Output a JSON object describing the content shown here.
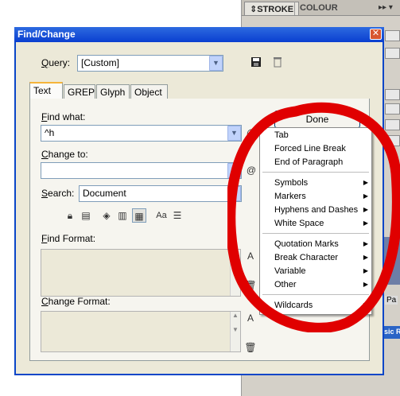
{
  "background_panel": {
    "tabs": [
      "STROKE",
      "COLOUR"
    ],
    "active_tab": "STROKE",
    "partial_labels": [
      "Pa",
      "sic R"
    ]
  },
  "dialog": {
    "title": "Find/Change",
    "close_icon": "close-icon",
    "query": {
      "label": "Query:",
      "value": "[Custom]"
    },
    "tabs": [
      {
        "label": "Text",
        "active": true
      },
      {
        "label": "GREP",
        "active": false
      },
      {
        "label": "Glyph",
        "active": false
      },
      {
        "label": "Object",
        "active": false
      }
    ],
    "find_what": {
      "label": "Find what:",
      "value": "^h"
    },
    "change_to": {
      "label": "Change to:",
      "value": ""
    },
    "search": {
      "label": "Search:",
      "value": "Document"
    },
    "find_format": {
      "label": "Find Format:"
    },
    "change_format": {
      "label": "Change Format:"
    },
    "done_button": "Done",
    "option_icon_text": "Aa"
  },
  "special_chars_menu": {
    "items": [
      {
        "label": "Tab",
        "submenu": false
      },
      {
        "label": "Forced Line Break",
        "submenu": false
      },
      {
        "label": "End of Paragraph",
        "submenu": false
      },
      {
        "separator": true
      },
      {
        "label": "Symbols",
        "submenu": true
      },
      {
        "label": "Markers",
        "submenu": true
      },
      {
        "label": "Hyphens and Dashes",
        "submenu": true
      },
      {
        "label": "White Space",
        "submenu": true
      },
      {
        "separator": true
      },
      {
        "label": "Quotation Marks",
        "submenu": true
      },
      {
        "label": "Break Character",
        "submenu": true
      },
      {
        "label": "Variable",
        "submenu": true
      },
      {
        "label": "Other",
        "submenu": true
      },
      {
        "separator": true
      },
      {
        "label": "Wildcards",
        "submenu": true
      }
    ]
  },
  "colors": {
    "annotation_red": "#e00000",
    "titlebar_blue": "#0a46c8",
    "dialog_bg": "#ece9d8"
  }
}
